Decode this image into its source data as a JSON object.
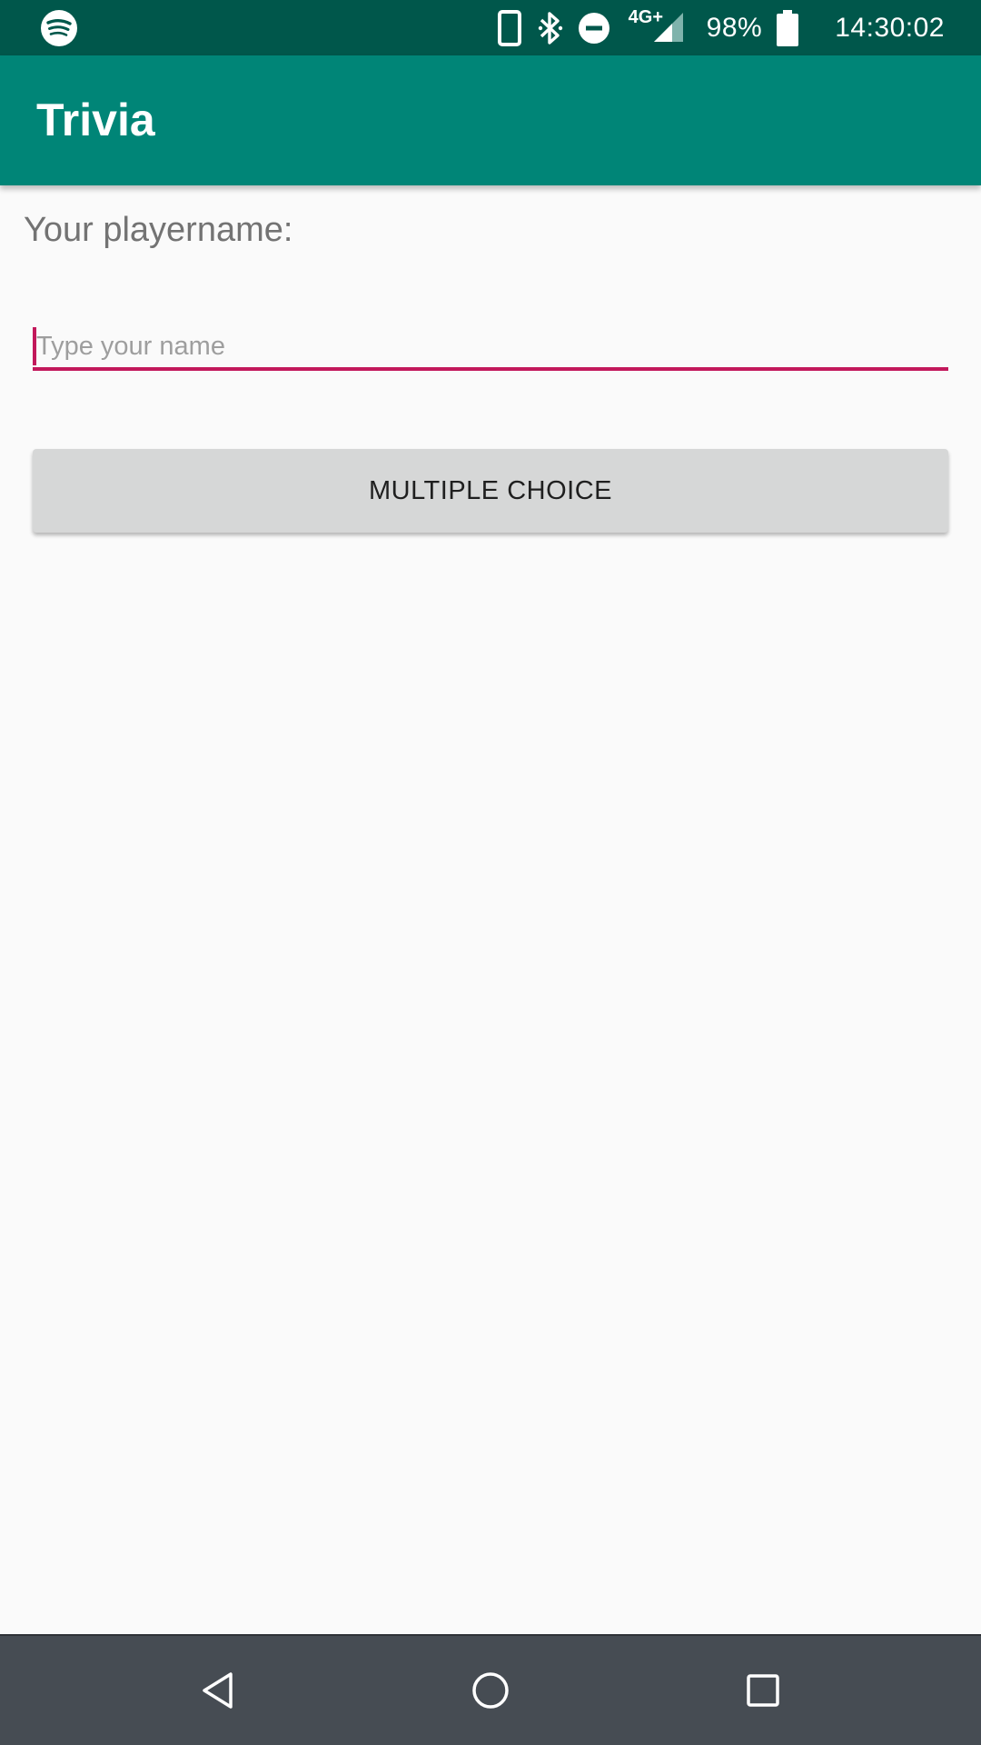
{
  "status_bar": {
    "left_icon": "spotify-icon",
    "icons": [
      "phone-icon",
      "bluetooth-icon",
      "do-not-disturb-icon",
      "signal-icon",
      "battery-icon"
    ],
    "network": "4G+",
    "battery": "98%",
    "time": "14:30:02"
  },
  "app_bar": {
    "title": "Trivia"
  },
  "form": {
    "label": "Your playername:",
    "name_input": {
      "value": "",
      "placeholder": "Type your name"
    },
    "multiple_choice_label": "MULTIPLE CHOICE"
  },
  "nav_bar": {
    "icons": [
      "back-icon",
      "home-icon",
      "recents-icon"
    ]
  },
  "colors": {
    "status_bar": "#00574b",
    "app_bar": "#008577",
    "accent": "#c2185b",
    "background": "#fafafa",
    "button": "#d6d7d7",
    "nav_bar": "#464c53"
  }
}
